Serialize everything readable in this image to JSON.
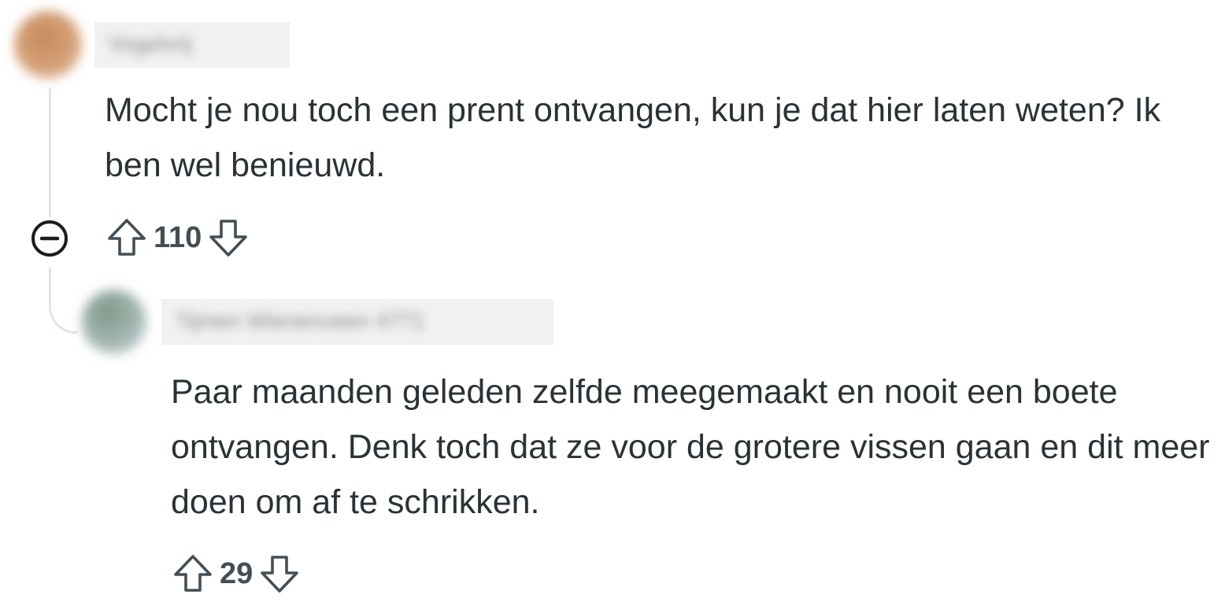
{
  "comments": [
    {
      "username": "Vogelvrij",
      "body": "Mocht je nou toch een prent ontvangen, kun je dat hier laten weten? Ik ben wel benieuwd.",
      "score": "110",
      "avatar_icon": "avatar-icon",
      "collapse_icon": "collapse-minus-icon"
    },
    {
      "username": "Tijmen Wienenveen 4771",
      "body": "Paar maanden geleden zelfde meegemaakt en nooit een boete ontvangen. Denk toch dat ze voor de grotere vissen gaan en dit meer doen om af te schrikken.",
      "score": "29",
      "avatar_icon": "avatar-icon"
    }
  ],
  "colors": {
    "text": "#2a3236",
    "vote_icon": "#444e54",
    "thread_line": "#e2e5e8"
  }
}
